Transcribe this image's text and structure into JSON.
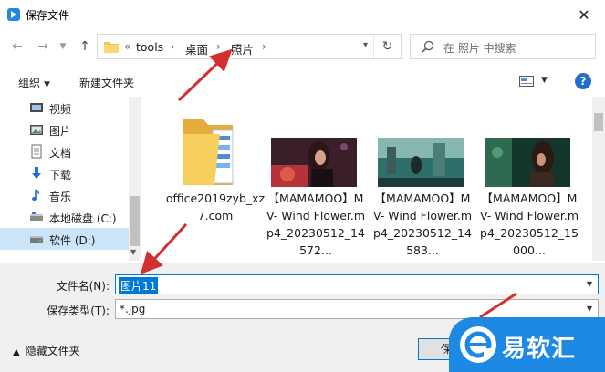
{
  "window": {
    "title": "保存文件"
  },
  "address": {
    "root_marker": "«",
    "segments": [
      "tools",
      "桌面",
      "照片"
    ]
  },
  "search": {
    "placeholder": "在 照片 中搜索"
  },
  "toolbar": {
    "organize_label": "组织",
    "new_folder_label": "新建文件夹"
  },
  "sidebar": {
    "items": [
      {
        "label": "视频",
        "icon": "video-icon"
      },
      {
        "label": "图片",
        "icon": "pictures-icon"
      },
      {
        "label": "文档",
        "icon": "documents-icon"
      },
      {
        "label": "下载",
        "icon": "download-icon"
      },
      {
        "label": "音乐",
        "icon": "music-icon"
      },
      {
        "label": "本地磁盘 (C:)",
        "icon": "drive-icon"
      },
      {
        "label": "软件 (D:)",
        "icon": "drive-icon",
        "selected": true
      }
    ]
  },
  "files": [
    {
      "name": "office2019zyb_xz7.com",
      "type": "folder"
    },
    {
      "name": "【MAMAMOO】MV- Wind Flower.mp4_20230512_14572...",
      "type": "image"
    },
    {
      "name": "【MAMAMOO】MV- Wind Flower.mp4_20230512_14583...",
      "type": "image"
    },
    {
      "name": "【MAMAMOO】MV- Wind Flower.mp4_20230512_15000...",
      "type": "image"
    }
  ],
  "form": {
    "filename_label": "文件名(N):",
    "filename_value": "图片11",
    "filetype_label": "保存类型(T):",
    "filetype_value": "*.jpg"
  },
  "footer": {
    "hide_folders_label": "隐藏文件夹",
    "save_label": "保"
  },
  "watermark": {
    "text": "易软汇"
  },
  "colors": {
    "accent": "#0078d7",
    "selection": "#cce4f7",
    "annotation_arrow": "#d32f2f",
    "watermark": "#1e88e5"
  }
}
